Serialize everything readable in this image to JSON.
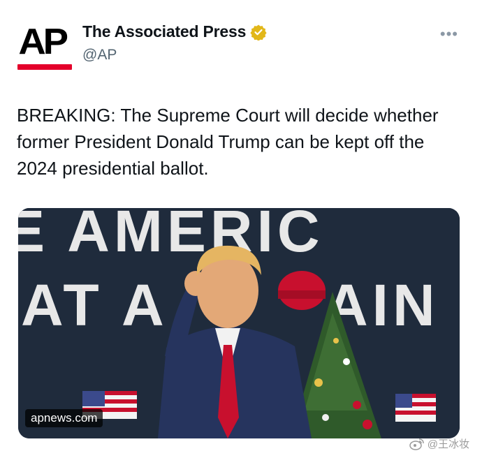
{
  "tweet": {
    "author_name": "The Associated Press",
    "handle": "@AP",
    "logo_text": "AP",
    "text": "BREAKING: The Supreme Court will decide whether former President Donald Trump can be kept off the 2024 presidential ballot.",
    "more_icon": "more-horizontal-icon",
    "verified_icon": "verified-gold-badge-icon"
  },
  "media": {
    "source_label": "apnews.com",
    "banner_line_1": "E AMERIC",
    "banner_line_2": "AT A",
    "banner_line_2b": "AIN"
  },
  "watermark": {
    "text": "@王冰妆",
    "icon": "weibo-icon"
  },
  "colors": {
    "ap_red": "#e4002b",
    "verified_gold": "#e2b719",
    "handle_gray": "#536471",
    "banner_navy": "#1f2b3c",
    "tie_red": "#c8102e"
  }
}
